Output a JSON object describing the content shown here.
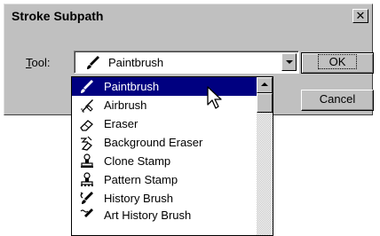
{
  "dialog": {
    "title": "Stroke Subpath",
    "close_glyph": "✕"
  },
  "tool_field": {
    "label_underlined": "T",
    "label_rest": "ool:",
    "selected_value": "Paintbrush",
    "selected_icon": "paintbrush-icon"
  },
  "buttons": {
    "ok": "OK",
    "cancel": "Cancel"
  },
  "dropdown": {
    "items": [
      {
        "label": "Paintbrush",
        "icon": "paintbrush-icon",
        "selected": true
      },
      {
        "label": "Airbrush",
        "icon": "airbrush-icon",
        "selected": false
      },
      {
        "label": "Eraser",
        "icon": "eraser-icon",
        "selected": false
      },
      {
        "label": "Background Eraser",
        "icon": "background-eraser-icon",
        "selected": false
      },
      {
        "label": "Clone Stamp",
        "icon": "clone-stamp-icon",
        "selected": false
      },
      {
        "label": "Pattern Stamp",
        "icon": "pattern-stamp-icon",
        "selected": false
      },
      {
        "label": "History Brush",
        "icon": "history-brush-icon",
        "selected": false
      },
      {
        "label": "Art History Brush",
        "icon": "art-history-brush-icon",
        "selected": false
      }
    ]
  },
  "colors": {
    "selection": "#000080",
    "face": "#c0c0c0"
  }
}
